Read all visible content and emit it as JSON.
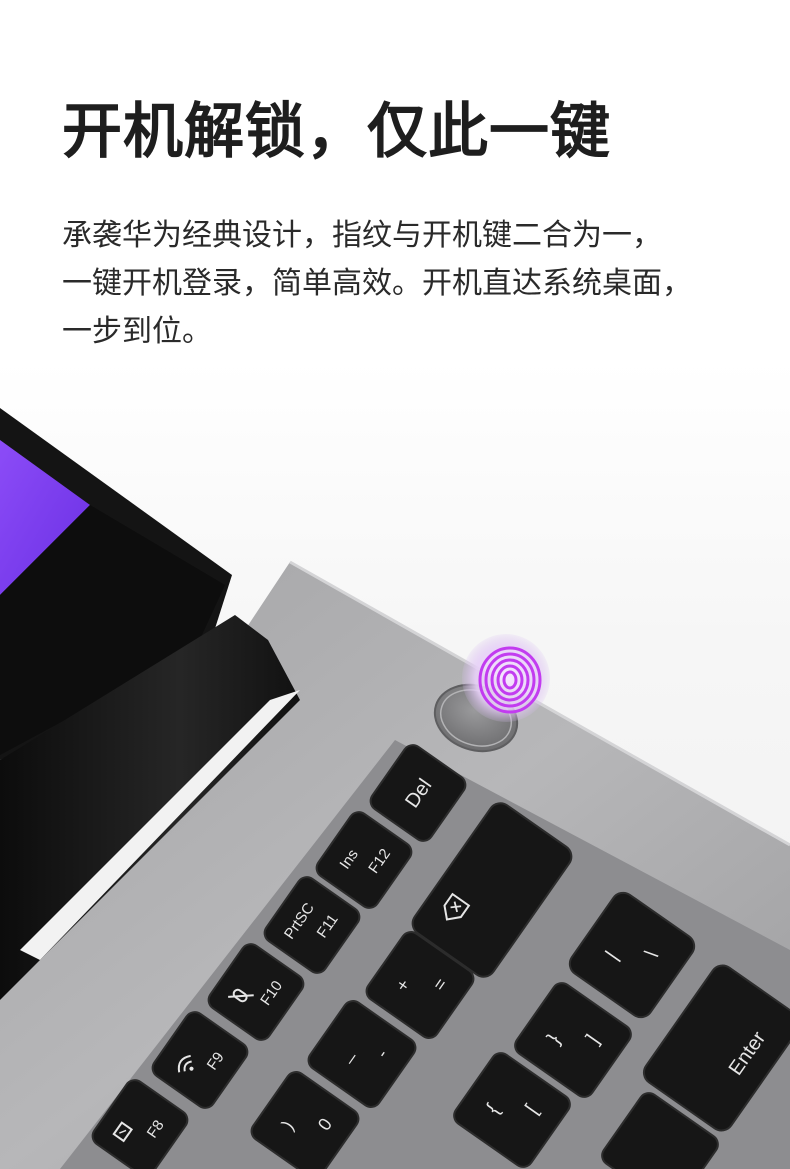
{
  "headline": "开机解锁，仅此一键",
  "description": [
    "承袭华为经典设计，指纹与开机键二合为一，",
    "一键开机登录，简单高效。开机直达系统桌面，",
    "一步到位。"
  ],
  "keys": {
    "del": "Del",
    "ins": "Ins",
    "f12": "F12",
    "prtsc": "PrtSC",
    "f11": "F11",
    "f10": "F10",
    "f9": "F9",
    "f8": "F8",
    "enter": "Enter",
    "plus": "+",
    "equals": "=",
    "minus": "-",
    "underscore": "_",
    "paren_close": ")",
    "zero": "0",
    "brace_close": "}",
    "bracket_close": "]",
    "brace_open": "{",
    "bracket_open": "[",
    "pipe": "|",
    "backslash": "\\"
  },
  "colors": {
    "accent_purple": "#c23cf0",
    "screen_purple": "#7a3cf5",
    "key_black": "#161616",
    "deck_silver": "#a8a8aa"
  }
}
